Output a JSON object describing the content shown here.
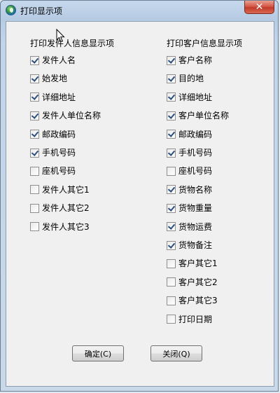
{
  "window": {
    "title": "打印显示项",
    "close_label": "✕"
  },
  "sender": {
    "title": "打印发件人信息显示项",
    "items": [
      {
        "label": "发件人名",
        "checked": true
      },
      {
        "label": "始发地",
        "checked": true
      },
      {
        "label": "详细地址",
        "checked": true
      },
      {
        "label": "发件人单位名称",
        "checked": true
      },
      {
        "label": "邮政编码",
        "checked": true
      },
      {
        "label": "手机号码",
        "checked": true
      },
      {
        "label": "座机号码",
        "checked": false
      },
      {
        "label": "发件人其它1",
        "checked": false
      },
      {
        "label": "发件人其它2",
        "checked": false
      },
      {
        "label": "发件人其它3",
        "checked": false
      }
    ]
  },
  "customer": {
    "title": "打印客户信息显示项",
    "items": [
      {
        "label": "客户名称",
        "checked": true
      },
      {
        "label": "目的地",
        "checked": true
      },
      {
        "label": "详细地址",
        "checked": true
      },
      {
        "label": "客户单位名称",
        "checked": true
      },
      {
        "label": "邮政编码",
        "checked": true
      },
      {
        "label": "手机号码",
        "checked": true
      },
      {
        "label": "座机号码",
        "checked": false
      },
      {
        "label": "货物名称",
        "checked": true
      },
      {
        "label": "货物重量",
        "checked": true
      },
      {
        "label": "货物运费",
        "checked": true
      },
      {
        "label": "货物备注",
        "checked": true
      },
      {
        "label": "客户其它1",
        "checked": false
      },
      {
        "label": "客户其它2",
        "checked": false
      },
      {
        "label": "客户其它3",
        "checked": false
      },
      {
        "label": "打印日期",
        "checked": false
      }
    ]
  },
  "buttons": {
    "ok_label": "确定(C)",
    "close_label": "关闭(Q)"
  }
}
